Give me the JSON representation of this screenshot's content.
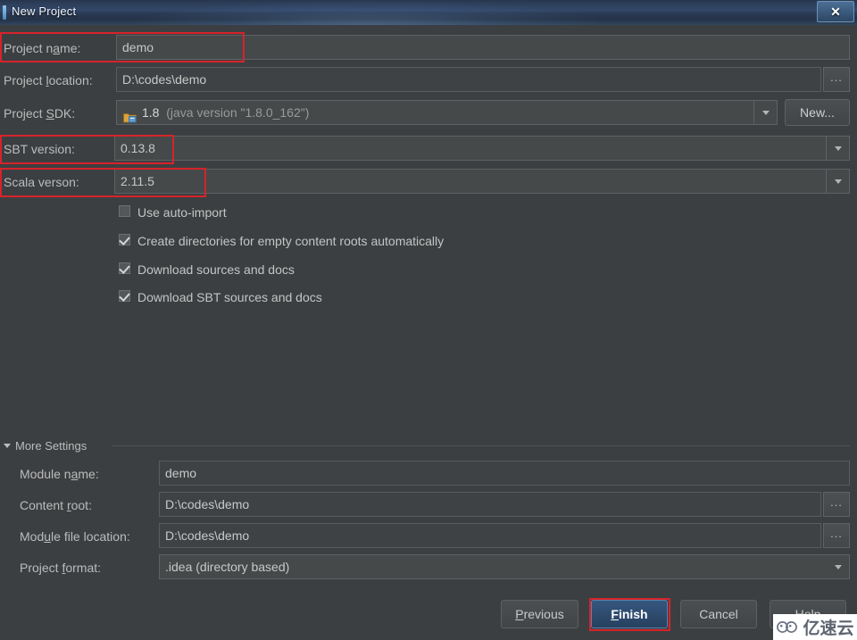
{
  "window": {
    "title": "New Project",
    "close_label": "✕"
  },
  "form": {
    "project_name": {
      "label_pre": "Project n",
      "label_mn": "a",
      "label_post": "me:",
      "value": "demo"
    },
    "project_location": {
      "label_pre": "Project ",
      "label_mn": "l",
      "label_post": "ocation:",
      "value": "D:\\codes\\demo",
      "browse_label": "..."
    },
    "project_sdk": {
      "label_pre": "Project ",
      "label_mn": "S",
      "label_post": "DK:",
      "value_strong": "1.8",
      "value_rest": "(java version \"1.8.0_162\")",
      "new_button_pre": "Ne",
      "new_button_mn": "w",
      "new_button_post": "..."
    },
    "sbt_version": {
      "label": "SBT version:",
      "value": "0.13.8"
    },
    "scala_version": {
      "label": "Scala verson:",
      "value": "2.11.5"
    }
  },
  "checkboxes": [
    {
      "label": "Use auto-import",
      "checked": false
    },
    {
      "label": "Create directories for empty content roots automatically",
      "checked": true
    },
    {
      "label": "Download sources and docs",
      "checked": true
    },
    {
      "label": "Download SBT sources and docs",
      "checked": true
    }
  ],
  "more_settings": {
    "label_pre": "Mor",
    "label_mn": "e",
    "label_post": " Settings",
    "module_name": {
      "label_pre": "Module n",
      "label_mn": "a",
      "label_post": "me:",
      "value": "demo"
    },
    "content_root": {
      "label_pre": "Content ",
      "label_mn": "r",
      "label_post": "oot:",
      "value": "D:\\codes\\demo",
      "browse_label": "..."
    },
    "module_file_location": {
      "label_pre": "Mod",
      "label_mn": "u",
      "label_post": "le file location:",
      "value": "D:\\codes\\demo",
      "browse_label": "..."
    },
    "project_format": {
      "label_pre": "Project ",
      "label_mn": "f",
      "label_post": "ormat:",
      "value": ".idea (directory based)"
    }
  },
  "buttons": {
    "previous": {
      "pre": "",
      "mn": "P",
      "post": "revious"
    },
    "finish": {
      "pre": "",
      "mn": "F",
      "post": "inish"
    },
    "cancel": {
      "pre": "Cancel",
      "mn": "",
      "post": ""
    },
    "help": {
      "pre": "Hel",
      "mn": "p",
      "post": ""
    }
  },
  "watermark": {
    "text": "亿速云"
  },
  "colors": {
    "background": "#3c3f41",
    "field_background": "#45494a",
    "field_border": "#5e6264",
    "text": "#bbbbbb",
    "accent_primary": "#36577f",
    "annotation_red": "#d6232a",
    "titlebar_blue": "#2c3d58"
  }
}
